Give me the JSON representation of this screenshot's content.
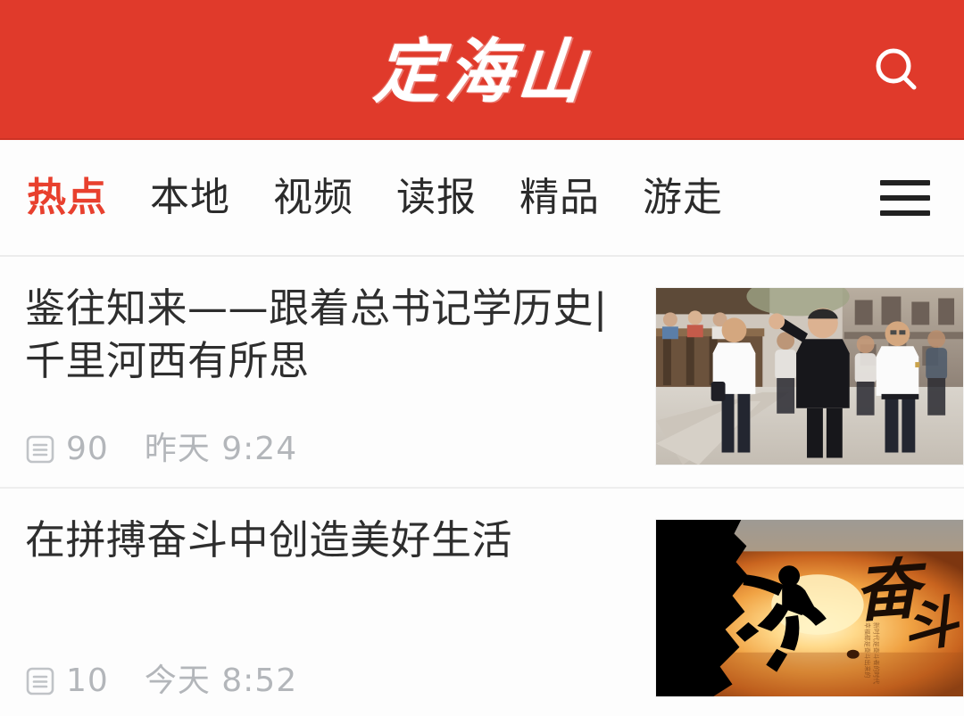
{
  "header": {
    "logo_text": "定海山",
    "search_icon": "search-icon",
    "brand_color": "#e03a2b"
  },
  "tabbar": {
    "menu_icon": "hamburger-menu-icon",
    "active_color": "#e8402e",
    "tabs": [
      {
        "label": "热点",
        "active": true
      },
      {
        "label": "本地",
        "active": false
      },
      {
        "label": "视频",
        "active": false
      },
      {
        "label": "读报",
        "active": false
      },
      {
        "label": "精品",
        "active": false
      },
      {
        "label": "游走",
        "active": false
      }
    ]
  },
  "feed": {
    "articles": [
      {
        "title": "鉴往知来——跟着总书记学历史|千里河西有所思",
        "read_icon": "article-document-icon",
        "read_count": "90",
        "time": "昨天 9:24",
        "thumb_alt": "leaders-walking-at-grottoes-photo"
      },
      {
        "title": "在拼搏奋斗中创造美好生活",
        "read_icon": "article-document-icon",
        "read_count": "10",
        "time": "今天 8:52",
        "thumb_alt": "climber-silhouette-sunset-fendou-poster",
        "thumb_calligraphy": "奋斗"
      }
    ]
  }
}
